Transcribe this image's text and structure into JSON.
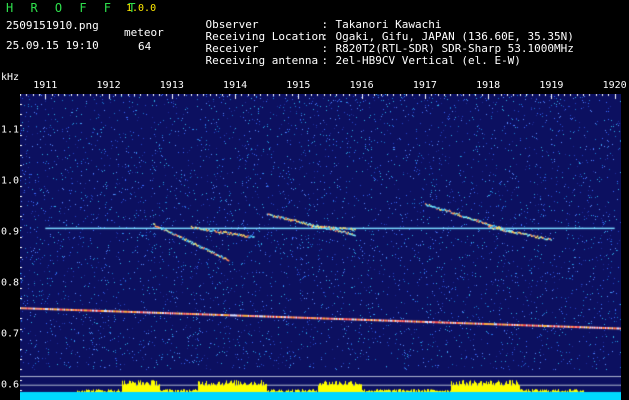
{
  "header": {
    "brand": "H R O F F T",
    "version": "1.0.0",
    "filename": "2509151910.png",
    "datetime": "25.09.15 19:10",
    "detection_label": "meteor",
    "detection_count": "64",
    "info": [
      {
        "label": "Observer",
        "value": "Takanori Kawachi"
      },
      {
        "label": "Receiving Location",
        "value": "Ogaki, Gifu, JAPAN (136.60E, 35.35N)"
      },
      {
        "label": "Receiver",
        "value": "R820T2(RTL-SDR) SDR-Sharp 53.1000MHz"
      },
      {
        "label": "Receiving antenna",
        "value": "2el-HB9CV Vertical (el. E-W)"
      }
    ]
  },
  "chart_data": {
    "type": "heatmap",
    "ylabel": "kHz",
    "x_ticks": [
      "1911",
      "1912",
      "1913",
      "1914",
      "1915",
      "1916",
      "1917",
      "1918",
      "1919",
      "1920"
    ],
    "y_ticks": [
      "1.1",
      "1.0",
      "0.9",
      "0.8",
      "0.7",
      "0.6"
    ],
    "ylim": [
      0.57,
      1.17
    ],
    "xlim": [
      1910.6,
      1920.1
    ],
    "carrier_tone": {
      "y": 0.908,
      "x": [
        1911.0,
        1920.0
      ]
    },
    "reference_line": {
      "y_start": 0.752,
      "y_end": 0.712
    },
    "guard_lines": [
      0.617,
      0.6,
      0.582
    ],
    "meteor_echoes": [
      {
        "x1": 1912.7,
        "y1": 0.915,
        "x2": 1913.9,
        "y2": 0.845
      },
      {
        "x1": 1913.3,
        "y1": 0.91,
        "x2": 1914.3,
        "y2": 0.89
      },
      {
        "x1": 1914.5,
        "y1": 0.935,
        "x2": 1915.9,
        "y2": 0.895
      },
      {
        "x1": 1915.2,
        "y1": 0.912,
        "x2": 1915.9,
        "y2": 0.905
      },
      {
        "x1": 1917.0,
        "y1": 0.955,
        "x2": 1918.4,
        "y2": 0.9
      },
      {
        "x1": 1918.0,
        "y1": 0.91,
        "x2": 1919.0,
        "y2": 0.885
      }
    ],
    "colors": {
      "background": "#0c1060",
      "noise": "#3a6cff",
      "tone": "#7ad8ff",
      "echo": "#ffe066",
      "guard": "#b0b8d0",
      "level_bar": "#ffff00",
      "level_base": "#00d8ff"
    }
  }
}
